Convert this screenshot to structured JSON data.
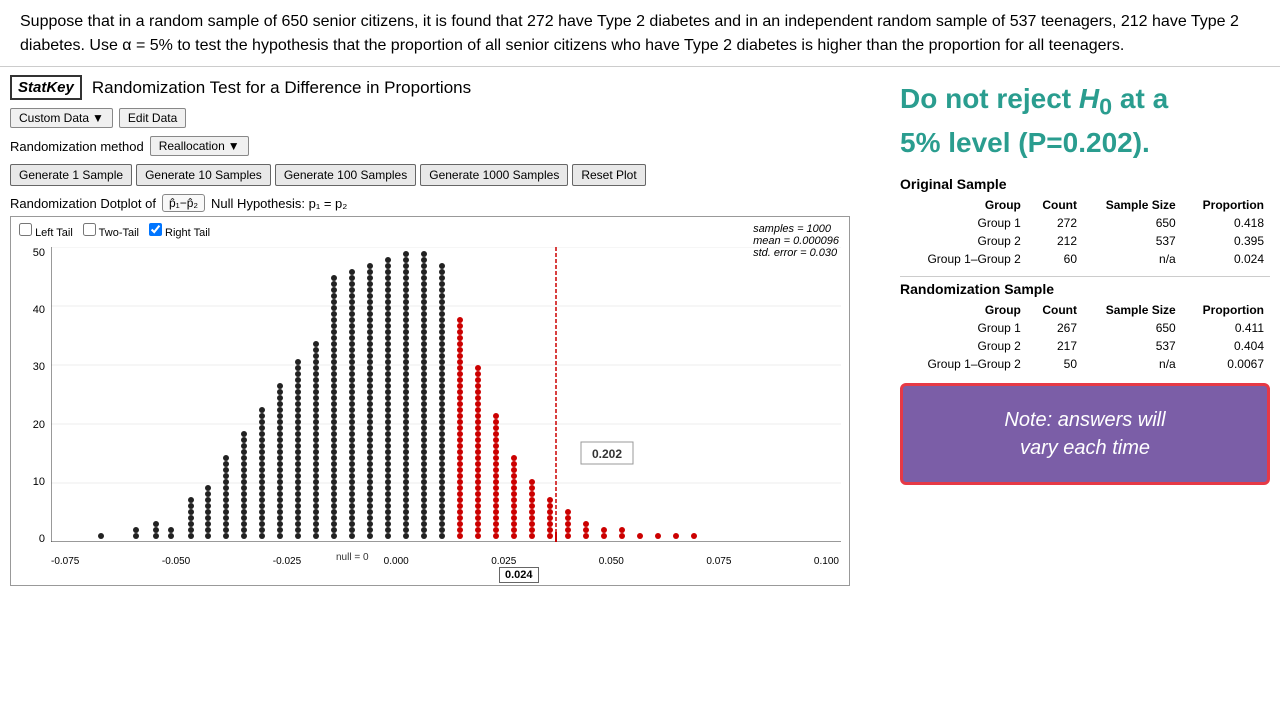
{
  "top_text": "Suppose that in a random sample of 650 senior citizens, it is found that 272 have Type 2 diabetes and in an independent random sample of 537 teenagers, 212 have Type 2 diabetes.  Use α = 5% to test the hypothesis that the proportion of all senior citizens who have Type 2 diabetes is higher than the proportion for all teenagers.",
  "statkey": {
    "logo": "StatKey",
    "title": "Randomization Test for a Difference in Proportions"
  },
  "toolbar": {
    "custom_data": "Custom Data",
    "custom_dropdown_arrow": "▼",
    "edit_data": "Edit Data"
  },
  "rand_method": {
    "label": "Randomization method",
    "method": "Reallocation",
    "dropdown_arrow": "▼"
  },
  "generate_buttons": [
    "Generate 1 Sample",
    "Generate 10 Samples",
    "Generate 100 Samples",
    "Generate 1000 Samples"
  ],
  "reset_plot": "Reset Plot",
  "dotplot": {
    "label": "Randomization Dotplot of",
    "statistic": "p̂₁−p̂₂",
    "null_hypothesis": "Null Hypothesis: p₁ = p₂"
  },
  "tail_checkboxes": {
    "left_tail": "Left Tail",
    "two_tail": "Two-Tail",
    "right_tail": "Right Tail",
    "right_checked": true
  },
  "chart_stats": {
    "samples": "samples = 1000",
    "mean": "mean = 0.000096",
    "std_error": "std. error = 0.030"
  },
  "chart_annotation": "0.202",
  "null_label": "null = 0",
  "value_box_024": "0.024",
  "y_axis_labels": [
    "50",
    "40",
    "30",
    "20",
    "10",
    "0"
  ],
  "x_axis_labels": [
    "-0.075",
    "-0.050",
    "-0.025",
    "0.000",
    "0.025",
    "0.050",
    "0.075",
    "0.100"
  ],
  "result": {
    "line1": "Do not reject H",
    "h0_sub": "0",
    "line2": "at a",
    "line3": "5% level (P=0.202)."
  },
  "original_sample": {
    "title": "Original Sample",
    "headers": [
      "Group",
      "Count",
      "Sample Size",
      "Proportion"
    ],
    "rows": [
      [
        "Group 1",
        "272",
        "650",
        "0.418"
      ],
      [
        "Group 2",
        "212",
        "537",
        "0.395"
      ],
      [
        "Group 1–Group 2",
        "60",
        "n/a",
        "0.024"
      ]
    ]
  },
  "randomization_sample": {
    "title": "Randomization Sample",
    "headers": [
      "Group",
      "Count",
      "Sample Size",
      "Proportion"
    ],
    "rows": [
      [
        "Group 1",
        "267",
        "650",
        "0.411"
      ],
      [
        "Group 2",
        "217",
        "537",
        "0.404"
      ],
      [
        "Group 1–Group 2",
        "50",
        "n/a",
        "0.0067"
      ]
    ]
  },
  "note_box": {
    "line1": "Note: answers will",
    "line2": "vary each time"
  },
  "colors": {
    "teal": "#2a9d8f",
    "purple": "#7b5ea7",
    "red_border": "#e63946",
    "red_dot": "#cc0000",
    "black_dot": "#222"
  }
}
